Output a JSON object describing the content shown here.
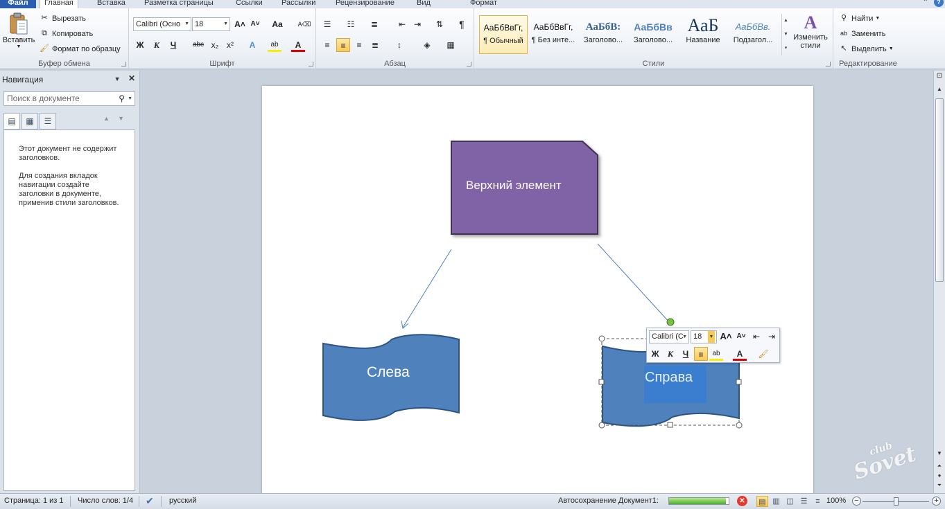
{
  "tabs": [
    {
      "label": "Файл"
    },
    {
      "label": "Главная"
    },
    {
      "label": "Вставка"
    },
    {
      "label": "Разметка страницы"
    },
    {
      "label": "Ссылки"
    },
    {
      "label": "Рассылки"
    },
    {
      "label": "Рецензирование"
    },
    {
      "label": "Вид"
    },
    {
      "label": "Формат"
    }
  ],
  "ribbon": {
    "clipboard": {
      "paste": "Вставить",
      "cut": "Вырезать",
      "copy": "Копировать",
      "format_painter": "Формат по образцу",
      "label": "Буфер обмена"
    },
    "font": {
      "name": "Calibri (Осно",
      "size": "18",
      "label": "Шрифт",
      "bold": "Ж",
      "italic": "К",
      "underline": "Ч",
      "strike": "abc",
      "sub": "x₂",
      "sup": "x²",
      "grow": "A˄",
      "shrink": "A˅",
      "case": "Aa",
      "color_letter": "A"
    },
    "paragraph": {
      "label": "Абзац",
      "pilcrow": "¶"
    },
    "styles": {
      "label": "Стили",
      "items": [
        {
          "preview": "АаБбВвГг,",
          "name": "¶ Обычный"
        },
        {
          "preview": "АаБбВвГг,",
          "name": "¶ Без инте..."
        },
        {
          "preview": "АаБбВ:",
          "name": "Заголово..."
        },
        {
          "preview": "АаБбВв",
          "name": "Заголово..."
        },
        {
          "preview": "АаБ",
          "name": "Название"
        },
        {
          "preview": "АаБбВв.",
          "name": "Подзагол..."
        }
      ],
      "change": "Изменить стили"
    },
    "editing": {
      "find": "Найти",
      "replace": "Заменить",
      "select": "Выделить",
      "label": "Редактирование"
    }
  },
  "nav": {
    "title": "Навигация",
    "search_placeholder": "Поиск в документе",
    "msg1": "Этот документ не содержит заголовков.",
    "msg2": "Для создания вкладок навигации создайте заголовки в документе, применив стили заголовков."
  },
  "document": {
    "top_text": "Верхний  элемент",
    "left_text": "Слева",
    "right_text": "Справа"
  },
  "mini_toolbar": {
    "font": "Calibri (С",
    "size": "18",
    "bold": "Ж",
    "italic": "К",
    "underline": "Ч",
    "color_letter": "A"
  },
  "status": {
    "page": "Страница: 1 из 1",
    "words": "Число слов: 1/4",
    "lang": "русский",
    "autosave": "Автосохранение Документ1:",
    "autosave_progress": 0.95,
    "zoom": "100%"
  },
  "watermark": {
    "line1": "club",
    "line2": "Sovet"
  },
  "colors": {
    "purple_shape": "#8062a6",
    "blue_shape": "#4f81bd",
    "file_tab": "#2a5db0"
  }
}
